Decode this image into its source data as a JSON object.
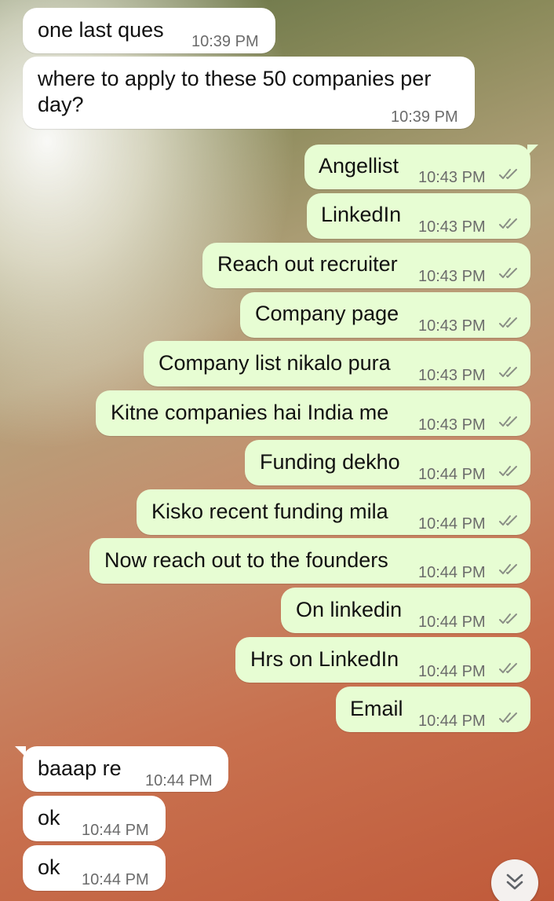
{
  "messages": [
    {
      "text": "one last ques",
      "time": "10:39 PM"
    },
    {
      "text_line1": "where to apply to these 50 companies per",
      "text_line2": "day?",
      "time": "10:39 PM"
    },
    {
      "text": "Angellist",
      "time": "10:43 PM"
    },
    {
      "text": "LinkedIn",
      "time": "10:43 PM"
    },
    {
      "text": "Reach out recruiter",
      "time": "10:43 PM"
    },
    {
      "text": "Company page",
      "time": "10:43 PM"
    },
    {
      "text": "Company list nikalo pura",
      "time": "10:43 PM"
    },
    {
      "text": "Kitne companies hai India me",
      "time": "10:43 PM"
    },
    {
      "text": "Funding dekho",
      "time": "10:44 PM"
    },
    {
      "text": "Kisko recent funding mila",
      "time": "10:44 PM"
    },
    {
      "text": "Now reach out to the founders",
      "time": "10:44 PM"
    },
    {
      "text": "On linkedin",
      "time": "10:44 PM"
    },
    {
      "text": "Hrs on LinkedIn",
      "time": "10:44 PM"
    },
    {
      "text": "Email",
      "time": "10:44 PM"
    },
    {
      "text": "baaap re",
      "time": "10:44 PM"
    },
    {
      "text": "ok",
      "time": "10:44 PM"
    },
    {
      "text": "ok",
      "time": "10:44 PM"
    }
  ],
  "icons": {
    "read_receipt": "double-check-icon",
    "scroll_down": "double-chevron-down-icon"
  },
  "colors": {
    "incoming_bubble": "#ffffff",
    "outgoing_bubble": "#e7fdd3",
    "read_ticks": "#8a8f86"
  }
}
